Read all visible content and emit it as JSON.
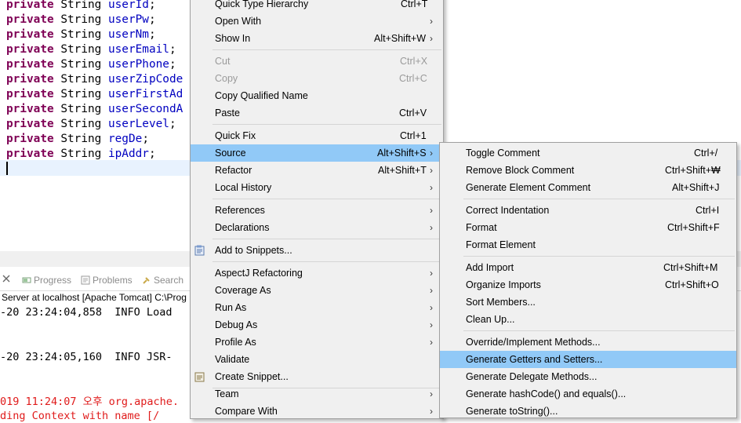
{
  "editor": {
    "code_lines": [
      {
        "kw": "private",
        "type": "String",
        "name": "userId",
        "punct": ";"
      },
      {
        "kw": "private",
        "type": "String",
        "name": "userPw",
        "punct": ";"
      },
      {
        "kw": "private",
        "type": "String",
        "name": "userNm",
        "punct": ";"
      },
      {
        "kw": "private",
        "type": "String",
        "name": "userEmail",
        "punct": ";"
      },
      {
        "kw": "private",
        "type": "String",
        "name": "userPhone",
        "punct": ";"
      },
      {
        "kw": "private",
        "type": "String",
        "name": "userZipCode",
        "punct": ""
      },
      {
        "kw": "private",
        "type": "String",
        "name": "userFirstAd",
        "punct": ""
      },
      {
        "kw": "private",
        "type": "String",
        "name": "userSecondA",
        "punct": ""
      },
      {
        "kw": "private",
        "type": "String",
        "name": "userLevel",
        "punct": ";"
      },
      {
        "kw": "private",
        "type": "String",
        "name": "regDe",
        "punct": ";"
      },
      {
        "kw": "private",
        "type": "String",
        "name": "ipAddr",
        "punct": ";"
      }
    ]
  },
  "console": {
    "tabs": {
      "progress": "Progress",
      "problems": "Problems",
      "search": "Search"
    },
    "title": "Server at localhost [Apache Tomcat] C:\\Prog",
    "lines": [
      "-20 23:24:04,858  INFO Load",
      "-20 23:24:05,160  INFO JSR-",
      "019 11:24:07 오후 org.apache.",
      "ding Context with name [/"
    ]
  },
  "context_menu": {
    "items": [
      {
        "label": "Quick Type Hierarchy",
        "shortcut": "Ctrl+T",
        "submenu": false,
        "disabled": false
      },
      {
        "label": "Open With",
        "shortcut": "",
        "submenu": true,
        "disabled": false
      },
      {
        "label": "Show In",
        "shortcut": "Alt+Shift+W",
        "submenu": true,
        "disabled": false
      },
      {
        "label": "Cut",
        "shortcut": "Ctrl+X",
        "submenu": false,
        "disabled": true
      },
      {
        "label": "Copy",
        "shortcut": "Ctrl+C",
        "submenu": false,
        "disabled": true
      },
      {
        "label": "Copy Qualified Name",
        "shortcut": "",
        "submenu": false,
        "disabled": false
      },
      {
        "label": "Paste",
        "shortcut": "Ctrl+V",
        "submenu": false,
        "disabled": false
      },
      {
        "label": "Quick Fix",
        "shortcut": "Ctrl+1",
        "submenu": false,
        "disabled": false
      },
      {
        "label": "Source",
        "shortcut": "Alt+Shift+S",
        "submenu": true,
        "disabled": false
      },
      {
        "label": "Refactor",
        "shortcut": "Alt+Shift+T",
        "submenu": true,
        "disabled": false
      },
      {
        "label": "Local History",
        "shortcut": "",
        "submenu": true,
        "disabled": false
      },
      {
        "label": "References",
        "shortcut": "",
        "submenu": true,
        "disabled": false
      },
      {
        "label": "Declarations",
        "shortcut": "",
        "submenu": true,
        "disabled": false
      },
      {
        "label": "Add to Snippets...",
        "shortcut": "",
        "submenu": false,
        "disabled": false
      },
      {
        "label": "AspectJ Refactoring",
        "shortcut": "",
        "submenu": true,
        "disabled": false
      },
      {
        "label": "Coverage As",
        "shortcut": "",
        "submenu": true,
        "disabled": false
      },
      {
        "label": "Run As",
        "shortcut": "",
        "submenu": true,
        "disabled": false
      },
      {
        "label": "Debug As",
        "shortcut": "",
        "submenu": true,
        "disabled": false
      },
      {
        "label": "Profile As",
        "shortcut": "",
        "submenu": true,
        "disabled": false
      },
      {
        "label": "Validate",
        "shortcut": "",
        "submenu": false,
        "disabled": false
      },
      {
        "label": "Create Snippet...",
        "shortcut": "",
        "submenu": false,
        "disabled": false
      },
      {
        "label": "Team",
        "shortcut": "",
        "submenu": true,
        "disabled": false
      },
      {
        "label": "Compare With",
        "shortcut": "",
        "submenu": true,
        "disabled": false
      }
    ],
    "highlighted": "Source"
  },
  "source_submenu": {
    "items": [
      {
        "label": "Toggle Comment",
        "shortcut": "Ctrl+/"
      },
      {
        "label": "Remove Block Comment",
        "shortcut": "Ctrl+Shift+₩"
      },
      {
        "label": "Generate Element Comment",
        "shortcut": "Alt+Shift+J"
      },
      {
        "label": "Correct Indentation",
        "shortcut": "Ctrl+I"
      },
      {
        "label": "Format",
        "shortcut": "Ctrl+Shift+F"
      },
      {
        "label": "Format Element",
        "shortcut": ""
      },
      {
        "label": "Add Import",
        "shortcut": "Ctrl+Shift+M"
      },
      {
        "label": "Organize Imports",
        "shortcut": "Ctrl+Shift+O"
      },
      {
        "label": "Sort Members...",
        "shortcut": ""
      },
      {
        "label": "Clean Up...",
        "shortcut": ""
      },
      {
        "label": "Override/Implement Methods...",
        "shortcut": ""
      },
      {
        "label": "Generate Getters and Setters...",
        "shortcut": ""
      },
      {
        "label": "Generate Delegate Methods...",
        "shortcut": ""
      },
      {
        "label": "Generate hashCode() and equals()...",
        "shortcut": ""
      },
      {
        "label": "Generate toString()...",
        "shortcut": ""
      }
    ],
    "highlighted": "Generate Getters and Setters..."
  },
  "colors": {
    "keyword": "#7f0055",
    "field": "#0000c0",
    "menu_highlight": "#91c9f7",
    "menu_background": "#f0f0f0",
    "console_error": "#e01b1b"
  }
}
